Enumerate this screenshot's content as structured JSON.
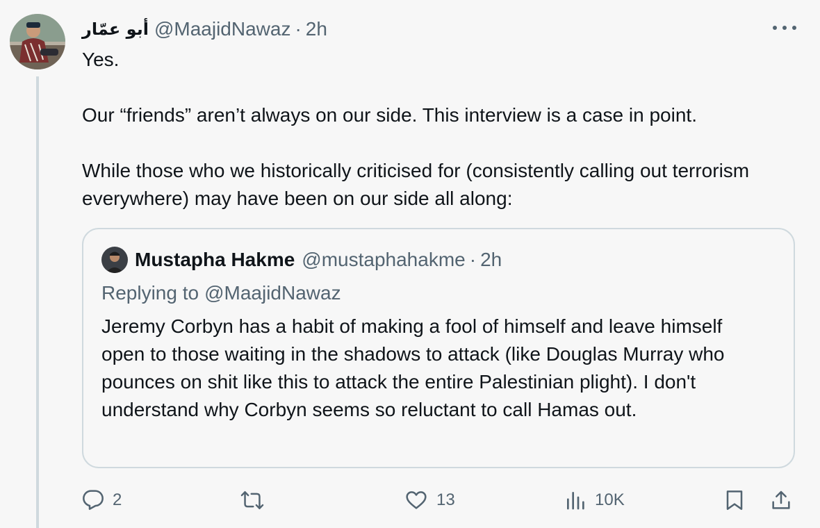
{
  "tweet": {
    "display_name": "أبو عمّار",
    "handle": "@MaajidNawaz",
    "separator": "·",
    "time": "2h",
    "paragraphs": [
      "Yes.",
      "Our “friends” aren’t always on our side. This interview is a case in point.",
      "While those who we historically criticised for (consistently calling out terrorism everywhere) may have been on our side all along:"
    ]
  },
  "quote": {
    "display_name": "Mustapha Hakme",
    "handle": "@mustaphahakme",
    "separator": "·",
    "time": "2h",
    "replying_label": "Replying to",
    "replying_handle": "@MaajidNawaz",
    "text": "Jeremy Corbyn has a habit of making a fool of himself and leave himself open to those waiting in the shadows to attack (like Douglas Murray who pounces on shit like this to attack the entire Palestinian plight). I don't understand why Corbyn seems so reluctant to call Hamas out."
  },
  "actions": {
    "reply_count": "2",
    "retweet_count": "",
    "like_count": "13",
    "views_count": "10K"
  },
  "icons": {
    "reply": "reply-icon",
    "retweet": "retweet-icon",
    "like": "heart-icon",
    "views": "views-icon",
    "bookmark": "bookmark-icon",
    "share": "share-icon",
    "more": "more-icon"
  },
  "colors": {
    "text": "#0f1419",
    "secondary": "#536471",
    "border": "#cfd9de",
    "background": "#f7f7f7"
  }
}
